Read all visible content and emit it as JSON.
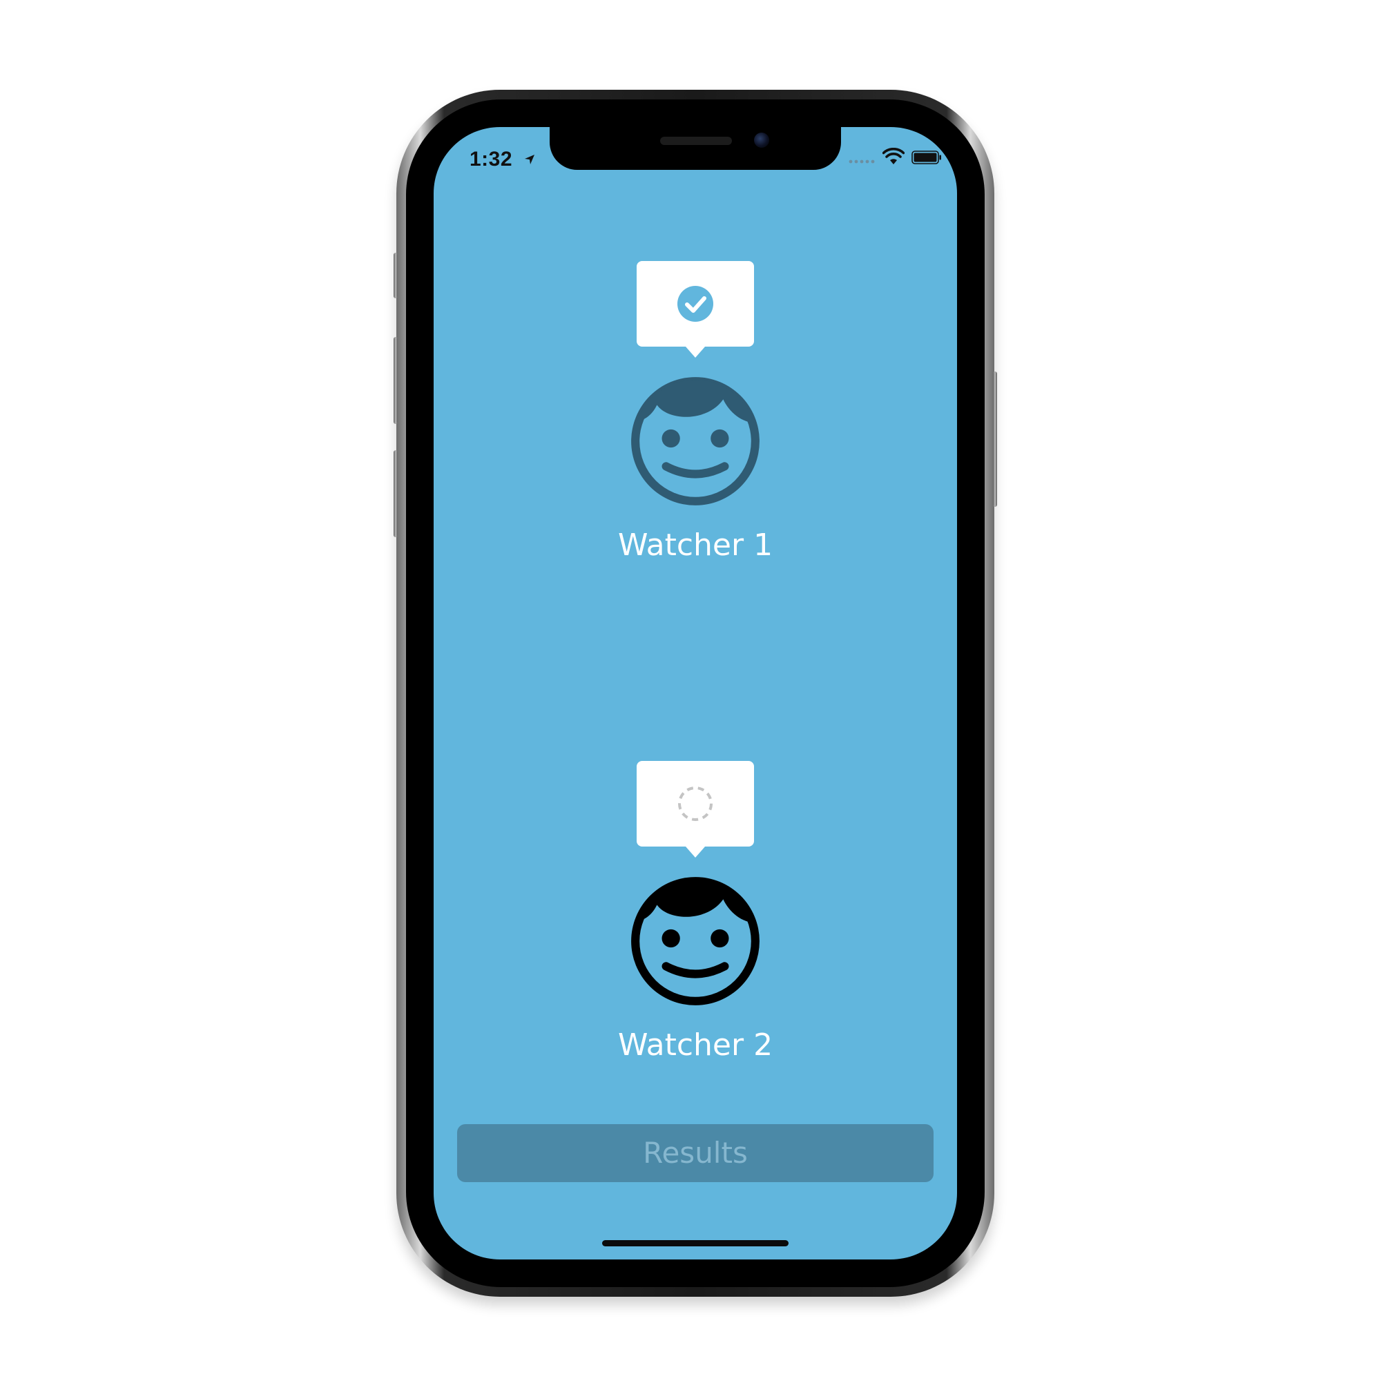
{
  "status_bar": {
    "time": "1:32",
    "location_icon": "location-arrow-icon",
    "signal_icon": "cellular-signal-icon",
    "wifi_icon": "wifi-icon",
    "battery_icon": "battery-icon"
  },
  "watchers": [
    {
      "name": "Watcher 1",
      "status": "done",
      "status_icon": "checkmark-circle-icon",
      "face_icon": "smiley-face-icon",
      "face_color": "#2f5b73"
    },
    {
      "name": "Watcher 2",
      "status": "waiting",
      "status_icon": "dashed-circle-icon",
      "face_icon": "smiley-face-icon",
      "face_color": "#000000"
    }
  ],
  "results_button": {
    "label": "Results",
    "enabled": false
  },
  "colors": {
    "background": "#61b6dd",
    "accent": "#61b6dd",
    "results_button_bg": "#4b89a7",
    "results_button_text": "#86b7cf",
    "bubble": "#ffffff",
    "pending_icon": "#c4c4c4"
  }
}
